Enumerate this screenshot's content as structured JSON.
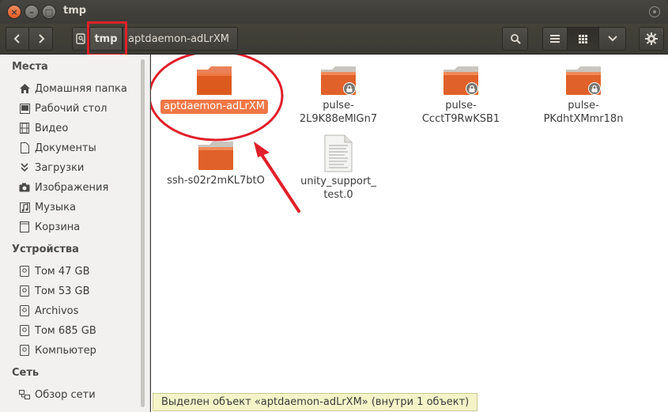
{
  "window": {
    "title": "tmp",
    "close_glyph": "×",
    "minimize_glyph": "–",
    "maximize_glyph": "□"
  },
  "pathbar": {
    "current": "tmp",
    "child": "aptdaemon-adLrXM"
  },
  "sidebar": {
    "places_heading": "Места",
    "places": [
      {
        "label": "Домашняя папка",
        "icon": "home-icon"
      },
      {
        "label": "Рабочий стол",
        "icon": "desktop-icon"
      },
      {
        "label": "Видео",
        "icon": "film-icon"
      },
      {
        "label": "Документы",
        "icon": "document-icon"
      },
      {
        "label": "Загрузки",
        "icon": "download-icon"
      },
      {
        "label": "Изображения",
        "icon": "camera-icon"
      },
      {
        "label": "Музыка",
        "icon": "music-icon"
      },
      {
        "label": "Корзина",
        "icon": "trash-icon"
      }
    ],
    "devices_heading": "Устройства",
    "devices": [
      {
        "label": "Том 47 GB",
        "icon": "drive-icon"
      },
      {
        "label": "Том 53 GB",
        "icon": "drive-icon"
      },
      {
        "label": "Archivos",
        "icon": "drive-icon"
      },
      {
        "label": "Том 685 GB",
        "icon": "drive-icon"
      },
      {
        "label": "Компьютер",
        "icon": "drive-icon"
      }
    ],
    "network_heading": "Сеть",
    "network": [
      {
        "label": "Обзор сети",
        "icon": "network-icon"
      }
    ]
  },
  "files": [
    {
      "name": "aptdaemon-adLrXM",
      "type": "folder",
      "selected": true,
      "locked": false
    },
    {
      "name1": "pulse-",
      "name2": "2L9K88eMlGn7",
      "type": "folder",
      "locked": true
    },
    {
      "name1": "pulse-",
      "name2": "CcctT9RwKSB1",
      "type": "folder",
      "locked": true
    },
    {
      "name1": "pulse-",
      "name2": "PKdhtXMmr18n",
      "type": "folder",
      "locked": true
    },
    {
      "name": "ssh-s02r2mKL7btO",
      "type": "folder",
      "locked": false
    },
    {
      "name1": "unity_support_",
      "name2": "test.0",
      "type": "text-file"
    }
  ],
  "status": "Выделен объект «aptdaemon-adLrXM» (внутри 1 объект)",
  "colors": {
    "accent": "#f07746",
    "folder_top": "#e9825a",
    "folder_body": "#dd5a1f",
    "annotation": "#e0202a"
  }
}
